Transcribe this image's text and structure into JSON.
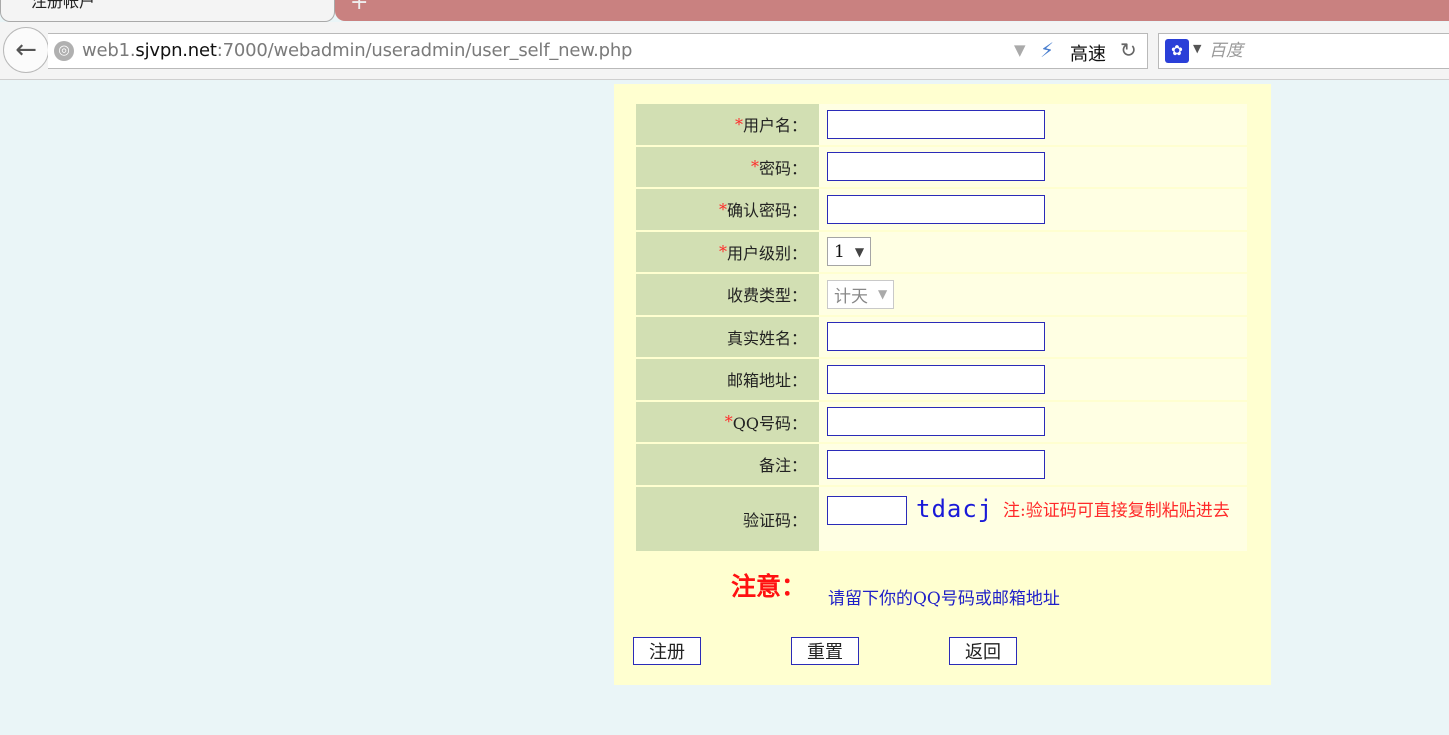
{
  "browser": {
    "tab_title": "注册帐户",
    "tab_close": "×",
    "new_tab": "+",
    "url_host_pre": "web1.",
    "url_host": "sjvpn.net",
    "url_path": ":7000/webadmin/useradmin/user_self_new.php",
    "speed_label": "高速",
    "search_placeholder": "百度"
  },
  "form": {
    "required_mark": "*",
    "fields": {
      "username": "用户名：",
      "password": "密码：",
      "confirm_password": "确认密码：",
      "user_level": "用户级别：",
      "billing_type": "收费类型：",
      "real_name": "真实姓名：",
      "email": "邮箱地址：",
      "qq": "QQ号码：",
      "remarks": "备注：",
      "captcha": "验证码："
    },
    "user_level_value": "1",
    "billing_type_value": "计天",
    "captcha_code": "tdacj",
    "captcha_note": "注:验证码可直接复制粘贴进去"
  },
  "notice": {
    "title": "注意：",
    "text": "请留下你的QQ号码或邮箱地址"
  },
  "buttons": {
    "register": "注册",
    "reset": "重置",
    "back": "返回"
  }
}
